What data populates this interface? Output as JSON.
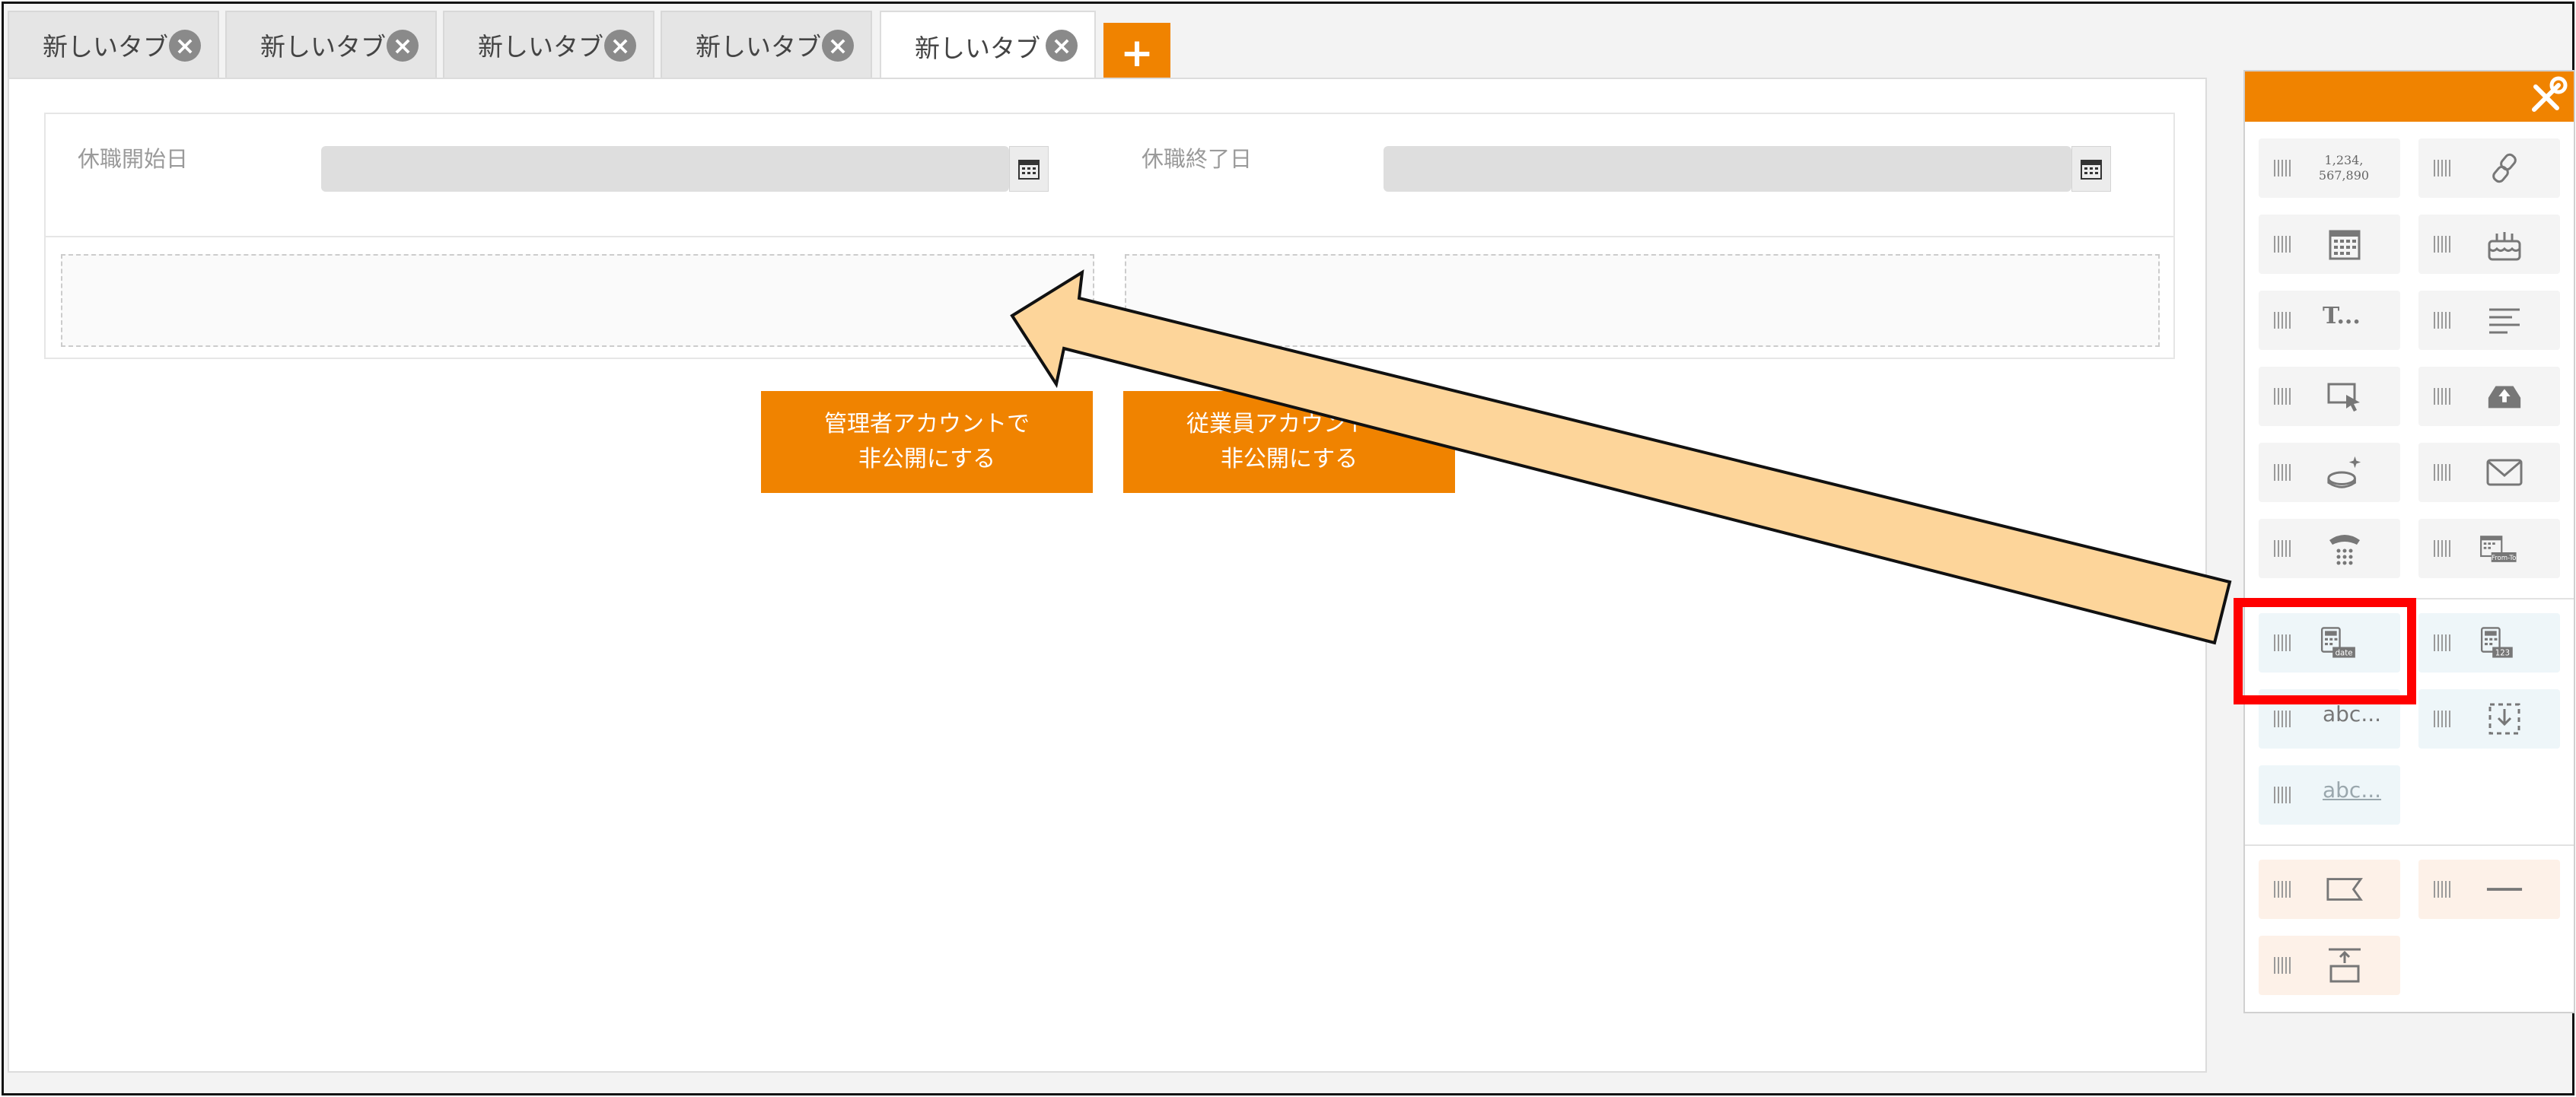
{
  "tabs": [
    {
      "label": "新しいタブ"
    },
    {
      "label": "新しいタブ"
    },
    {
      "label": "新しいタブ"
    },
    {
      "label": "新しいタブ"
    },
    {
      "label": "新しいタブ"
    }
  ],
  "add_tab_label": "+",
  "form": {
    "leave_start_label": "休職開始日",
    "leave_end_label": "休職終了日",
    "leave_start_value": "",
    "leave_end_value": ""
  },
  "buttons": {
    "admin_hide_line1": "管理者アカウントで",
    "admin_hide_line2": "非公開にする",
    "employee_hide_line1": "従業員アカウントで",
    "employee_hide_line2": "非公開にする"
  },
  "palette": {
    "number_icon_top": "1,234,",
    "number_icon_bottom": "567,890",
    "text_tool_label": "T...",
    "abc_tool_label": "abc...",
    "abc_underline_tool_label": "abc...",
    "calc_date_badge": "date",
    "calc_num_badge": "123",
    "from_to_badge": "From-To"
  },
  "colors": {
    "accent": "#f08300",
    "highlight": "#ff0000",
    "arrow_fill": "#fdd59a"
  }
}
